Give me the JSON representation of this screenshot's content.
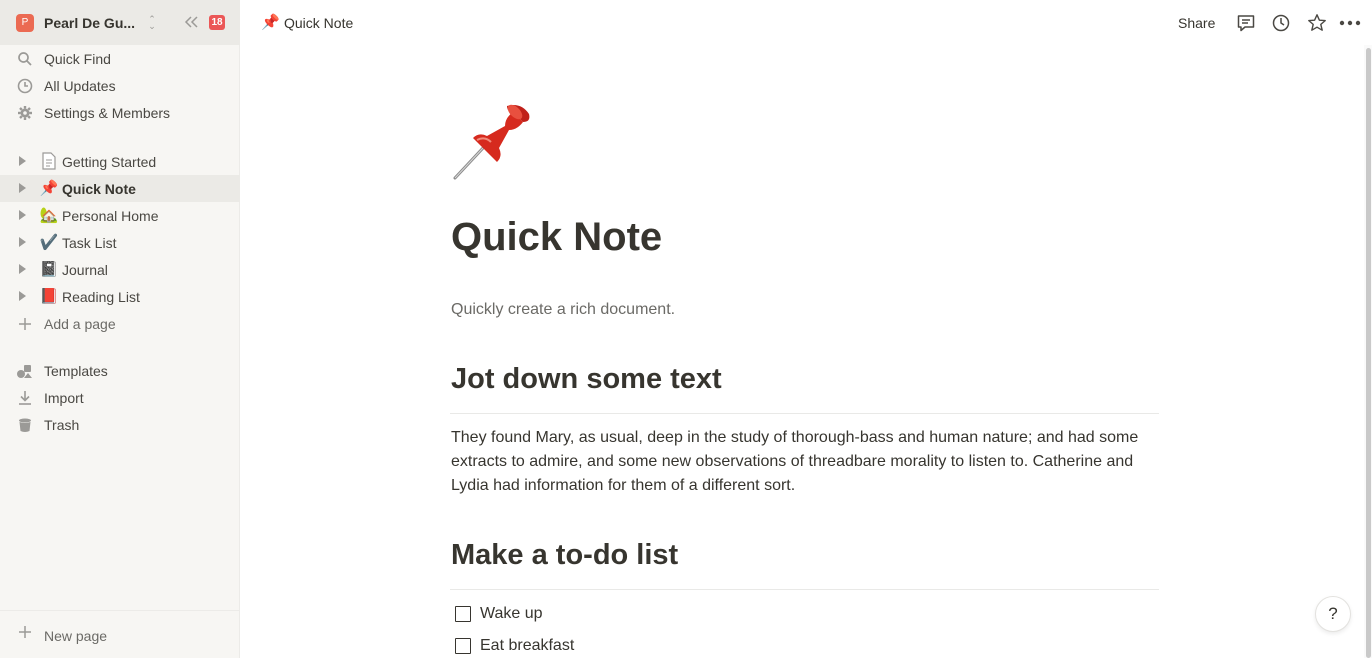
{
  "workspace": {
    "avatar_letter": "P",
    "name": "Pearl De Gu...",
    "badge_count": "18"
  },
  "sidebar": {
    "nav": [
      {
        "label": "Quick Find",
        "icon": "search-icon"
      },
      {
        "label": "All Updates",
        "icon": "clock-icon"
      },
      {
        "label": "Settings & Members",
        "icon": "gear-icon"
      }
    ],
    "pages": [
      {
        "label": "Getting Started",
        "icon": "📄"
      },
      {
        "label": "Quick Note",
        "icon": "📌",
        "active": true
      },
      {
        "label": "Personal Home",
        "icon": "🏡"
      },
      {
        "label": "Task List",
        "icon": "✔️"
      },
      {
        "label": "Journal",
        "icon": "📓"
      },
      {
        "label": "Reading List",
        "icon": "📕"
      }
    ],
    "add_page": "Add a page",
    "tools": [
      {
        "label": "Templates",
        "icon": "templates-icon"
      },
      {
        "label": "Import",
        "icon": "import-icon"
      },
      {
        "label": "Trash",
        "icon": "trash-icon"
      }
    ],
    "new_page": "New page"
  },
  "topbar": {
    "breadcrumb_icon": "📌",
    "breadcrumb_label": "Quick Note",
    "share_label": "Share",
    "icons": [
      "comment-icon",
      "history-icon",
      "star-icon",
      "more-icon"
    ]
  },
  "page": {
    "emoji": "📌",
    "title": "Quick Note",
    "subtitle": "Quickly create a rich document.",
    "section1_heading": "Jot down some text",
    "section1_text": "They found Mary, as usual, deep in the study of thorough-bass and human nature; and had some extracts to admire, and some new observations of threadbare morality to listen to. Catherine and Lydia had information for them of a different sort.",
    "section2_heading": "Make a to-do list",
    "todos": [
      {
        "label": "Wake up",
        "checked": false
      },
      {
        "label": "Eat breakfast",
        "checked": false
      }
    ]
  },
  "help": {
    "label": "?"
  },
  "colors": {
    "sidebar_bg": "#f7f6f3",
    "text": "#37352f",
    "accent_red": "#eb5757",
    "avatar": "#eb6a52"
  }
}
